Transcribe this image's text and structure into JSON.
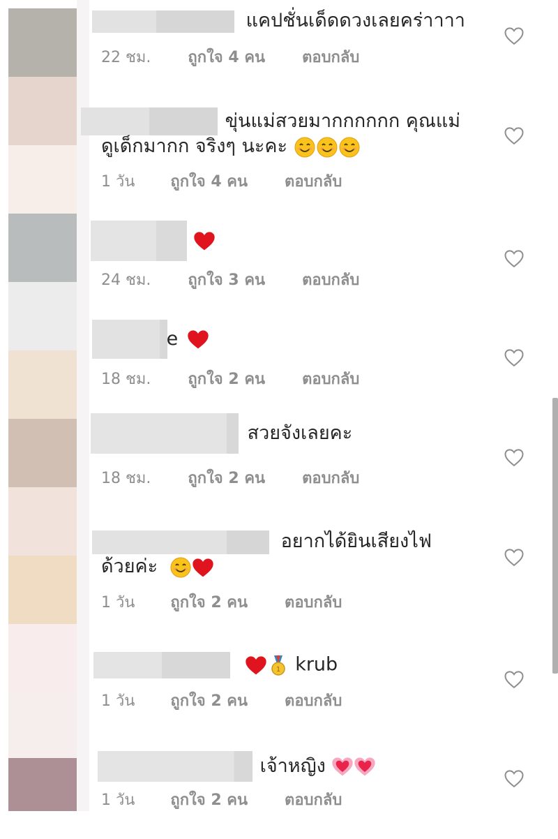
{
  "comments": [
    {
      "text": "แคปชั่นเด็ดดวงเลยคร่าาาา",
      "time": "22 ชม.",
      "likes": "ถูกใจ 4 คน",
      "reply": "ตอบกลับ"
    },
    {
      "text_line1": "ขุ่นแม่สวยมากกกกกก คุณแม่",
      "text_line2": "ดูเด็กมากก  จริงๆ นะคะ",
      "time": "1 วัน",
      "likes": "ถูกใจ 4 คน",
      "reply": "ตอบกลับ"
    },
    {
      "time": "24 ชม.",
      "likes": "ถูกใจ 3 คน",
      "reply": "ตอบกลับ"
    },
    {
      "text": "e",
      "time": "18 ชม.",
      "likes": "ถูกใจ 2 คน",
      "reply": "ตอบกลับ"
    },
    {
      "text": "สวยจังเลยคะ",
      "time": "18 ชม.",
      "likes": "ถูกใจ 2 คน",
      "reply": "ตอบกลับ"
    },
    {
      "text_line1": "อยากได้ยินเสียงไฟ",
      "text_line2": "ด้วยค่ะ",
      "time": "1 วัน",
      "likes": "ถูกใจ 2 คน",
      "reply": "ตอบกลับ"
    },
    {
      "text": "krub",
      "time": "1 วัน",
      "likes": "ถูกใจ 2 คน",
      "reply": "ตอบกลับ"
    },
    {
      "text": "เจ้าหญิง",
      "time": "1 วัน",
      "likes": "ถูกใจ 2 คน",
      "reply": "ตอบกลับ"
    }
  ],
  "icons": {
    "like": "heart-outline-icon",
    "emoji_heart": "red-heart-emoji",
    "emoji_smile": "smiling-face-emoji",
    "emoji_medal": "gold-medal-emoji",
    "emoji_sparkle_heart": "growing-heart-emoji"
  },
  "colors": {
    "text": "#262626",
    "meta": "#8e8e8e",
    "heart": "#e0141e",
    "blur": "#dcdcdc"
  }
}
